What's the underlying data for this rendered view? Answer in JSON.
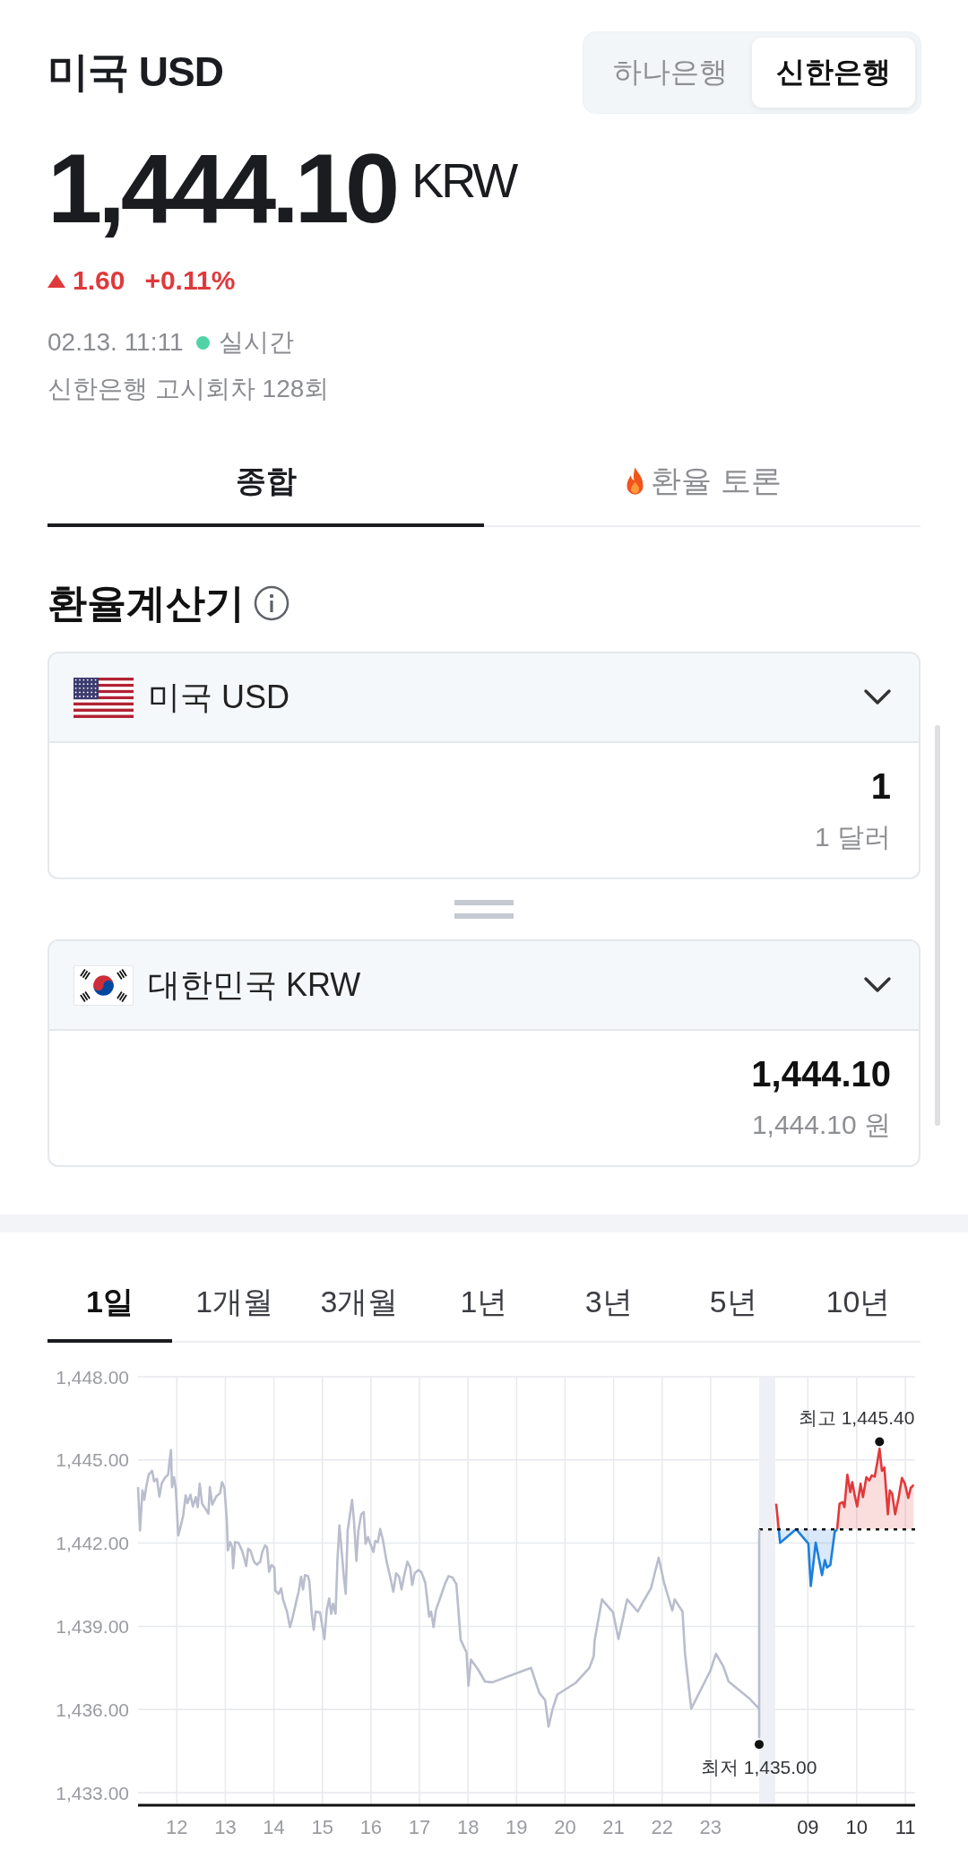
{
  "header": {
    "title": "미국 USD",
    "bank_tabs": [
      {
        "label": "하나은행",
        "selected": false
      },
      {
        "label": "신한은행",
        "selected": true
      }
    ]
  },
  "quote": {
    "price": "1,444.10",
    "unit": "KRW",
    "rising": true,
    "change": "1.60",
    "change_rate": "+0.11%",
    "time": "02.13. 11:11",
    "live": true,
    "live_label": "실시간",
    "notice": "신한은행 고시회차 128회"
  },
  "tabs": [
    {
      "label": "종합",
      "selected": true,
      "kind": "plain"
    },
    {
      "label": "환율 토론",
      "selected": false,
      "kind": "hot"
    }
  ],
  "calculator": {
    "title": "환율계산기",
    "currencies": [
      {
        "kind": "us",
        "name": "미국 USD",
        "amount": "1",
        "amount_text": "1 달러"
      },
      {
        "kind": "kr",
        "name": "대한민국 KRW",
        "amount": "1,444.10",
        "amount_text": "1,444.10 원"
      }
    ]
  },
  "chart": {
    "periods": [
      {
        "label": "1일",
        "selected": true
      },
      {
        "label": "1개월",
        "selected": false
      },
      {
        "label": "3개월",
        "selected": false
      },
      {
        "label": "1년",
        "selected": false
      },
      {
        "label": "3년",
        "selected": false
      },
      {
        "label": "5년",
        "selected": false
      },
      {
        "label": "10년",
        "selected": false
      }
    ],
    "panels": [
      {
        "chart_data": {
          "type": "line",
          "grid": true,
          "xlim": [
            11.2,
            24
          ],
          "ylim": [
            1433,
            1448
          ],
          "xticks": [
            12,
            13,
            14,
            15,
            16,
            17,
            18,
            19,
            20,
            21,
            22,
            23
          ],
          "yticks": [
            {
              "value": 1448,
              "label": "1,448.00"
            },
            {
              "value": 1445,
              "label": "1,445.00"
            },
            {
              "value": 1442,
              "label": "1,442.00"
            },
            {
              "value": 1439,
              "label": "1,439.00"
            },
            {
              "value": 1436,
              "label": "1,436.00"
            },
            {
              "value": 1433,
              "label": "1,433.00"
            }
          ],
          "x": [
            11.2,
            11.24,
            11.29,
            11.33,
            11.37,
            11.42,
            11.49,
            11.53,
            11.59,
            11.64,
            11.69,
            11.75,
            11.82,
            11.85,
            11.88,
            11.9,
            11.94,
            11.98,
            12.03,
            12.08,
            12.13,
            12.18,
            12.22,
            12.28,
            12.33,
            12.39,
            12.43,
            12.47,
            12.52,
            12.59,
            12.65,
            12.68,
            12.73,
            12.81,
            12.89,
            12.93,
            12.98,
            13.03,
            13.05,
            13.1,
            13.14,
            13.16,
            13.2,
            13.27,
            13.34,
            13.39,
            13.43,
            13.47,
            13.52,
            13.59,
            13.65,
            13.72,
            13.76,
            13.82,
            13.86,
            13.9,
            13.95,
            14.01,
            14.03,
            14.1,
            14.15,
            14.19,
            14.27,
            14.33,
            14.39,
            14.46,
            14.51,
            14.56,
            14.6,
            14.64,
            14.7,
            14.73,
            14.78,
            14.82,
            14.86,
            14.95,
            14.99,
            15.04,
            15.09,
            15.14,
            15.18,
            15.22,
            15.27,
            15.31,
            15.35,
            15.39,
            15.44,
            15.48,
            15.52,
            15.56,
            15.61,
            15.65,
            15.7,
            15.74,
            15.8,
            15.85,
            15.89,
            15.94,
            15.99,
            16.05,
            16.09,
            16.14,
            16.19,
            16.25,
            16.32,
            16.4,
            16.46,
            16.52,
            16.58,
            16.63,
            16.68,
            16.75,
            16.81,
            16.85,
            16.9,
            16.98,
            17.04,
            17.12,
            17.16,
            17.2,
            17.24,
            17.29,
            17.34,
            17.44,
            17.53,
            17.6,
            17.68,
            17.76,
            17.85,
            17.97,
            18.01,
            18.06,
            18.2,
            18.35,
            18.5,
            19.3,
            19.47,
            19.59,
            19.66,
            19.74,
            19.84,
            20.22,
            20.5,
            20.59,
            20.61,
            20.76,
            20.99,
            21.1,
            21.28,
            21.5,
            21.61,
            21.77,
            21.93,
            22.04,
            22.21,
            22.26,
            22.42,
            22.47,
            22.6,
            22.99,
            23.11,
            23.26,
            23.37,
            23.8,
            24,
            24,
            24
          ],
          "series": [
            {
              "color": "#b9bdcd",
              "values": [
                1444.02,
                1442.46,
                1443.9,
                1443.56,
                1444.04,
                1444.47,
                1444.61,
                1444.23,
                1444.32,
                1443.68,
                1444.16,
                1444.35,
                1444.47,
                1444.97,
                1445.36,
                1444.02,
                1444.38,
                1443.92,
                1442.28,
                1442.61,
                1443.0,
                1443.72,
                1443.44,
                1443.75,
                1443.32,
                1443.66,
                1443.3,
                1444.14,
                1443.42,
                1443.24,
                1443.06,
                1444.02,
                1443.39,
                1443.68,
                1443.8,
                1444.2,
                1443.99,
                1442.82,
                1441.74,
                1442.04,
                1441.86,
                1441.09,
                1442.04,
                1442.01,
                1441.74,
                1441.44,
                1441.17,
                1441.8,
                1441.72,
                1441.33,
                1441.22,
                1441.33,
                1441.68,
                1441.92,
                1441.84,
                1440.97,
                1441.21,
                1441.12,
                1440.28,
                1440.17,
                1440.37,
                1439.95,
                1439.53,
                1438.97,
                1439.35,
                1439.89,
                1440.25,
                1440.79,
                1440.33,
                1440.85,
                1440.81,
                1440.64,
                1439.45,
                1438.87,
                1439.53,
                1439.5,
                1439.09,
                1438.54,
                1439.59,
                1440.01,
                1439.45,
                1439.81,
                1439.45,
                1441.39,
                1442.64,
                1441.86,
                1440.79,
                1440.17,
                1442.46,
                1442.94,
                1443.56,
                1442.82,
                1441.36,
                1442.44,
                1443.04,
                1443.12,
                1441.98,
                1442.22,
                1441.96,
                1441.68,
                1442.08,
                1442.03,
                1442.51,
                1442.08,
                1441.36,
                1440.76,
                1440.25,
                1440.91,
                1440.79,
                1440.33,
                1440.79,
                1441.33,
                1441.12,
                1440.49,
                1440.91,
                1441.03,
                1440.95,
                1440.57,
                1439.95,
                1439.35,
                1439.53,
                1438.97,
                1439.59,
                1440.09,
                1440.55,
                1440.81,
                1440.76,
                1440.52,
                1438.51,
                1438.06,
                1436.86,
                1437.8,
                1437.46,
                1437.01,
                1436.98,
                1437.5,
                1436.6,
                1436.34,
                1435.38,
                1436.0,
                1436.54,
                1436.96,
                1437.5,
                1437.92,
                1438.51,
                1439.97,
                1439.5,
                1438.54,
                1439.97,
                1439.53,
                1439.89,
                1440.37,
                1441.48,
                1440.57,
                1439.57,
                1439.97,
                1439.53,
                1438.04,
                1436.03,
                1437.38,
                1438.01,
                1437.56,
                1437.01,
                1436.39,
                1436.03,
                1435.0,
                1442.5
              ]
            }
          ],
          "annotations": [
            {
              "x": 24,
              "y": 1435,
              "text": "최저 1,435.00"
            }
          ]
        }
      },
      {
        "chart_data": {
          "type": "area",
          "grid": true,
          "xlim": [
            8,
            11.2
          ],
          "ylim": [
            1433,
            1448
          ],
          "xticks": [
            {
              "value": 9,
              "label": "09"
            },
            {
              "value": 10,
              "label": "10"
            },
            {
              "value": 11,
              "label": "11"
            }
          ],
          "x": [
            8.35,
            8.4,
            8.43,
            8.76,
            9.01,
            9.06,
            9.16,
            9.23,
            9.29,
            9.35,
            9.39,
            9.46,
            9.55,
            9.6,
            9.65,
            9.71,
            9.75,
            9.81,
            9.87,
            9.91,
            9.96,
            10.01,
            10.08,
            10.13,
            10.2,
            10.26,
            10.31,
            10.37,
            10.43,
            10.47,
            10.52,
            10.57,
            10.64,
            10.68,
            10.73,
            10.79,
            10.86,
            10.93,
            10.99,
            11.06,
            11.11,
            11.17
          ],
          "series": [
            {
              "color": "#e2393b",
              "values": [
                1443.42,
                1442.5,
                null,
                null,
                null,
                null,
                null,
                null,
                null,
                null,
                null,
                null,
                null,
                1442.5,
                1443.42,
                1443.48,
                1443.3,
                1444.47,
                1443.84,
                1444.2,
                1443.72,
                1443.32,
                1444.14,
                1443.66,
                1444.38,
                1444.26,
                1444.44,
                1444.4,
                1444.97,
                1445.4,
                1444.61,
                1444.73,
                1443.04,
                1443.9,
                1443.78,
                1443.04,
                1443.63,
                1444.35,
                1444.14,
                1443.63,
                1443.99,
                1444.1
              ]
            },
            {
              "color": "#1d7fdd",
              "values": [
                null,
                1442.5,
                1442.01,
                1442.5,
                1441.98,
                1440.45,
                1442.02,
                1441.39,
                1440.85,
                1441.39,
                1441.12,
                1441.21,
                1442.4,
                1442.5,
                null,
                null,
                null,
                null,
                null,
                null,
                null,
                null,
                null,
                null,
                null,
                null,
                null,
                null,
                null,
                null,
                null,
                null,
                null,
                null,
                null,
                null,
                null,
                null,
                null,
                null,
                null,
                null
              ]
            }
          ],
          "ref_lines": [
            {
              "axis": "y",
              "value": 1442.5
            }
          ],
          "bands": [
            {
              "axis": "x",
              "from": 8,
              "to": 8.33
            }
          ],
          "annotations": [
            {
              "x": 10.47,
              "y": 1445.4,
              "text": "최고 1,445.40"
            }
          ]
        }
      }
    ]
  }
}
